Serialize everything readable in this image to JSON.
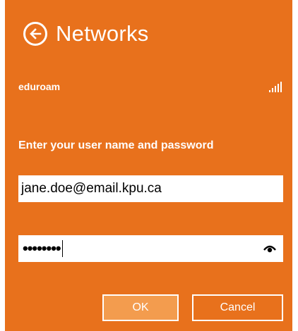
{
  "colors": {
    "background": "#E8711C",
    "ok_button_fill": "#F39C4E",
    "text": "#FFFFFF",
    "input_fill": "#FFFFFF"
  },
  "header": {
    "back_icon": "arrow-left-circle-icon",
    "title": "Networks"
  },
  "network": {
    "name": "eduroam",
    "signal_icon": "wifi-signal-bars-icon"
  },
  "login": {
    "prompt": "Enter your user name and password",
    "username_value": "jane.doe@email.kpu.ca",
    "password_masked": "••••••••",
    "reveal_icon": "eye-reveal-icon"
  },
  "buttons": {
    "ok_label": "OK",
    "cancel_label": "Cancel"
  }
}
